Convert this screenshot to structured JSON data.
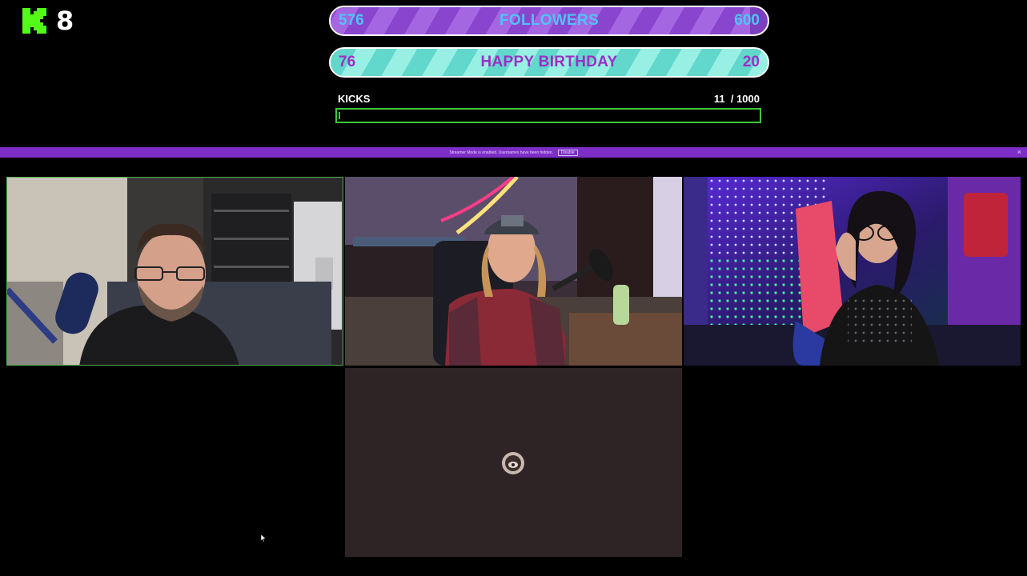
{
  "logo": {
    "platform_icon": "kick-k-icon",
    "count": "8",
    "brand_color": "#53fc18"
  },
  "goals": [
    {
      "id": "followers",
      "start": "576",
      "label": "FOLLOWERS",
      "end": "600",
      "progress": 0.96
    },
    {
      "id": "birthday",
      "start": "76",
      "label": "HAPPY BIRTHDAY",
      "end": "20",
      "progress": 1.0
    }
  ],
  "kicks": {
    "label": "KICKS",
    "current": "11",
    "goal": "/ 1000",
    "progress": 0.011,
    "color": "#3ec83a"
  },
  "banner": {
    "text": "Streamer Mode is enabled. Usernames have been hidden.",
    "button": "Disable",
    "close": "×",
    "color": "#7c2ec6"
  },
  "tiles": [
    {
      "id": "guest-1",
      "active": true
    },
    {
      "id": "guest-2",
      "active": false
    },
    {
      "id": "guest-3",
      "active": false
    },
    {
      "id": "guest-4",
      "video": "off",
      "icon": "avatar-icon"
    }
  ]
}
